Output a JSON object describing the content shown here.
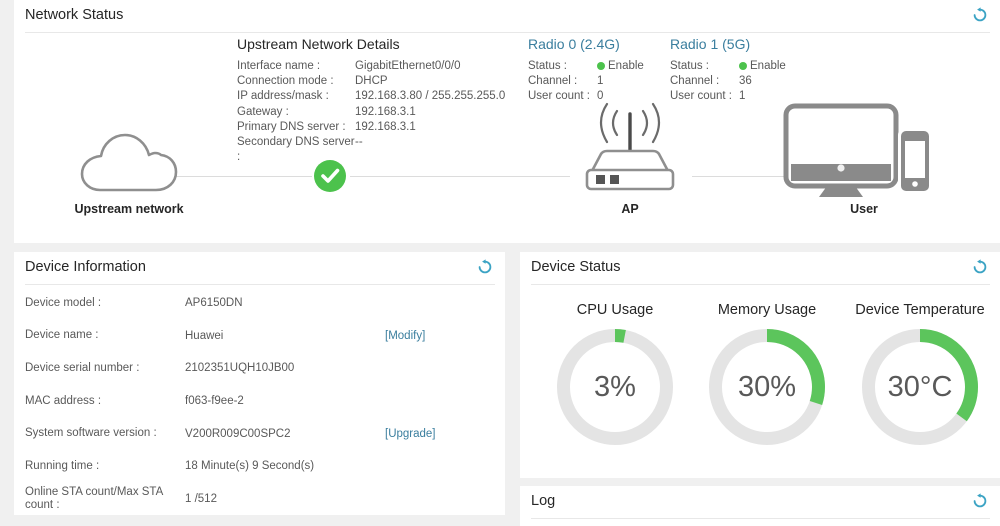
{
  "colors": {
    "accent_teal": "#3a7e9e",
    "refresh_icon": "#3ba3c4",
    "status_green": "#4cc24c",
    "gauge_green": "#5cc55c",
    "gauge_track": "#e4e4e4"
  },
  "network_status": {
    "title": "Network Status",
    "upstream_details": {
      "title": "Upstream Network Details",
      "rows": [
        {
          "label": "Interface name :",
          "value": "GigabitEthernet0/0/0"
        },
        {
          "label": "Connection mode :",
          "value": "DHCP"
        },
        {
          "label": "IP address/mask :",
          "value": "192.168.3.80 / 255.255.255.0"
        },
        {
          "label": "Gateway :",
          "value": "192.168.3.1"
        },
        {
          "label": "Primary DNS server :",
          "value": "192.168.3.1"
        },
        {
          "label": "Secondary DNS server :",
          "value": "--"
        }
      ]
    },
    "radios": [
      {
        "title": "Radio 0 (2.4G)",
        "status_label": "Status :",
        "status": "Enable",
        "channel_label": "Channel :",
        "channel": "1",
        "user_count_label": "User count :",
        "user_count": "0"
      },
      {
        "title": "Radio 1 (5G)",
        "status_label": "Status :",
        "status": "Enable",
        "channel_label": "Channel :",
        "channel": "36",
        "user_count_label": "User count :",
        "user_count": "1"
      }
    ],
    "diagram": {
      "upstream_label": "Upstream network",
      "ap_label": "AP",
      "user_label": "User"
    }
  },
  "device_info": {
    "title": "Device Information",
    "rows": [
      {
        "label": "Device model :",
        "value": "AP6150DN",
        "link": ""
      },
      {
        "label": "Device name :",
        "value": "Huawei",
        "link": "[Modify]"
      },
      {
        "label": "Device serial number :",
        "value": "2102351UQH10JB00",
        "link": ""
      },
      {
        "label": "MAC address :",
        "value": "f063-f9ee-2",
        "link": ""
      },
      {
        "label": "System software version :",
        "value": "V200R009C00SPC2",
        "link": "[Upgrade]"
      },
      {
        "label": "Running time :",
        "value": "18 Minute(s) 9 Second(s)",
        "link": ""
      },
      {
        "label": "Online STA count/Max STA count :",
        "value": "1 /512",
        "link": ""
      }
    ]
  },
  "device_status": {
    "title": "Device Status",
    "gauges": [
      {
        "label": "CPU Usage",
        "value": "3%",
        "fraction": 0.03
      },
      {
        "label": "Memory Usage",
        "value": "30%",
        "fraction": 0.3
      },
      {
        "label": "Device Temperature",
        "value": "30°C",
        "fraction": 0.35
      }
    ]
  },
  "log": {
    "title": "Log"
  }
}
